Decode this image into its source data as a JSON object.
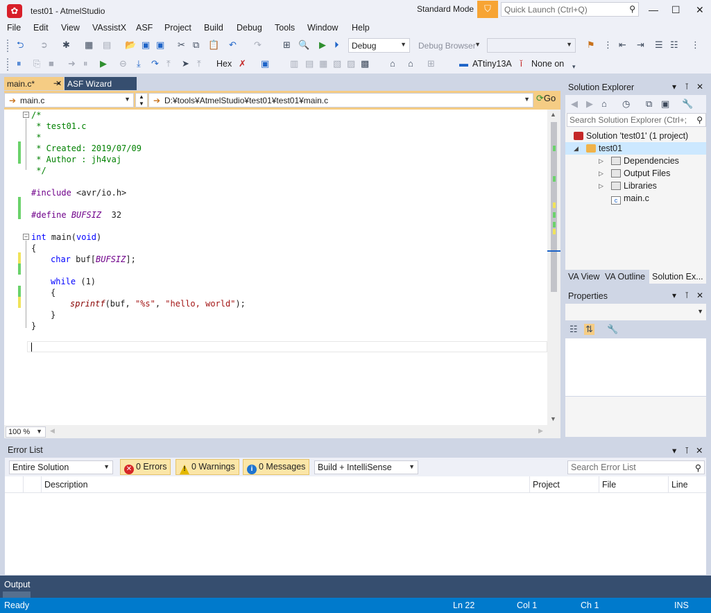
{
  "window": {
    "title": "test01 - AtmelStudio",
    "mode": "Standard Mode",
    "quick_launch_placeholder": "Quick Launch (Ctrl+Q)"
  },
  "menu": [
    "File",
    "Edit",
    "View",
    "VAssistX",
    "ASF",
    "Project",
    "Build",
    "Debug",
    "Tools",
    "Window",
    "Help"
  ],
  "toolbar": {
    "config": "Debug",
    "debug_browser": "Debug Browser",
    "hex": "Hex",
    "device": "ATtiny13A",
    "tool": "None on"
  },
  "tabs": [
    {
      "label": "main.c*",
      "active": true
    },
    {
      "label": "ASF Wizard",
      "active": false
    }
  ],
  "navbar": {
    "file": "main.c",
    "path": "D:¥tools¥AtmelStudio¥test01¥test01¥main.c",
    "go": "Go"
  },
  "code": {
    "l1": "/*",
    "l2": " * test01.c",
    "l3": " *",
    "l4": " * Created: 2019/07/09",
    "l5": " * Author : jh4vaj",
    "l6": " */",
    "include_kw": "#include",
    "include_path": " <avr/io.h>",
    "define_kw": "#define",
    "define_name": "BUFSIZ",
    "define_val": "  32",
    "int_kw": "int",
    "main_sig": " main(",
    "void_kw": "void",
    "main_close": ")",
    "brace_open": "{",
    "char_kw": "char",
    "buf_decl": " buf[",
    "bufsiz_ref": "BUFSIZ",
    "buf_end": "];",
    "while_kw": "while",
    "while_cond": " (1)",
    "inner_open": "{",
    "sprintf_fn": "sprintf",
    "sprintf_args1": "(buf, ",
    "fmt_str": "\"%s\"",
    "comma": ", ",
    "hello_str": "\"hello, world\"",
    "sprintf_end": ");",
    "inner_close": "}",
    "brace_close": "}"
  },
  "zoom": "100 %",
  "solution_explorer": {
    "title": "Solution Explorer",
    "search_placeholder": "Search Solution Explorer (Ctrl+;",
    "solution": "Solution 'test01' (1 project)",
    "project": "test01",
    "items": [
      "Dependencies",
      "Output Files",
      "Libraries",
      "main.c"
    ],
    "tabs": [
      "VA View",
      "VA Outline",
      "Solution Ex..."
    ]
  },
  "properties": {
    "title": "Properties"
  },
  "error_list": {
    "title": "Error List",
    "scope": "Entire Solution",
    "errors": "0 Errors",
    "warnings": "0 Warnings",
    "messages": "0 Messages",
    "source": "Build + IntelliSense",
    "search_placeholder": "Search Error List",
    "columns": [
      "Description",
      "Project",
      "File",
      "Line"
    ]
  },
  "output_tab": "Output",
  "status": {
    "state": "Ready",
    "ln": "Ln 22",
    "col": "Col 1",
    "ch": "Ch 1",
    "ins": "INS"
  },
  "colors": {
    "accent": "#007acc",
    "tab_active": "#f5cc84",
    "chrome": "#cfd6e5"
  }
}
